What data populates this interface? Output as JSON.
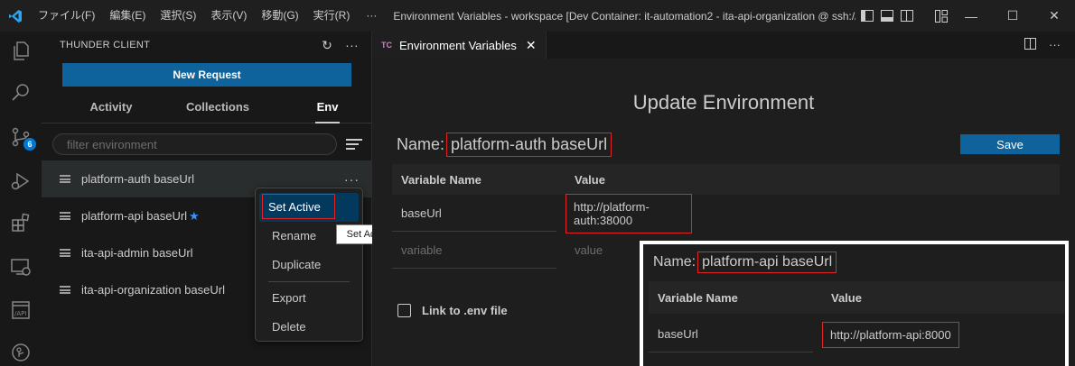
{
  "titlebar": {
    "menus": [
      "ファイル(F)",
      "編集(E)",
      "選択(S)",
      "表示(V)",
      "移動(G)",
      "実行(R)"
    ],
    "more": "···",
    "window_title": "Environment Variables - workspace [Dev Container: it-automation2 - ita-api-organization @ ssh://...",
    "minimize": "—",
    "maximize": "☐",
    "close": "✕"
  },
  "activity_bar": {
    "source_control_badge": "6"
  },
  "sidebar": {
    "title": "THUNDER CLIENT",
    "refresh": "↻",
    "more": "···",
    "new_request": "New Request",
    "tabs": [
      "Activity",
      "Collections",
      "Env"
    ],
    "active_tab": "Env",
    "filter_placeholder": "filter environment",
    "environments": [
      {
        "name": "platform-auth baseUrl",
        "active": false
      },
      {
        "name": "platform-api baseUrl",
        "active": true,
        "star": "★"
      },
      {
        "name": "ita-api-admin baseUrl",
        "active": false
      },
      {
        "name": "ita-api-organization baseUrl",
        "active": false
      }
    ],
    "item_more": "···"
  },
  "context_menu": {
    "items": [
      "Set Active",
      "Rename",
      "Duplicate",
      "Export",
      "Delete"
    ]
  },
  "tooltip": "Set Active Environment",
  "editor": {
    "tab_logo": "TC",
    "tab_title": "Environment Variables",
    "tab_close": "✕",
    "heading": "Update Environment",
    "name_label": "Name:",
    "name_value": "platform-auth baseUrl",
    "save": "Save",
    "columns": [
      "Variable Name",
      "Value"
    ],
    "rows": [
      {
        "name": "baseUrl",
        "value": "http://platform-auth:38000"
      }
    ],
    "new_row_placeholders": {
      "name": "variable",
      "value": "value"
    },
    "link_env": "Link to .env file"
  },
  "overlay": {
    "name_label": "Name:",
    "name_value": "platform-api baseUrl",
    "columns": [
      "Variable Name",
      "Value"
    ],
    "rows": [
      {
        "name": "baseUrl",
        "value": "http://platform-api:8000"
      }
    ]
  },
  "colors": {
    "accent": "#0e639c",
    "highlight": "#e02424",
    "selection": "#04395e",
    "star": "#3794ff"
  }
}
